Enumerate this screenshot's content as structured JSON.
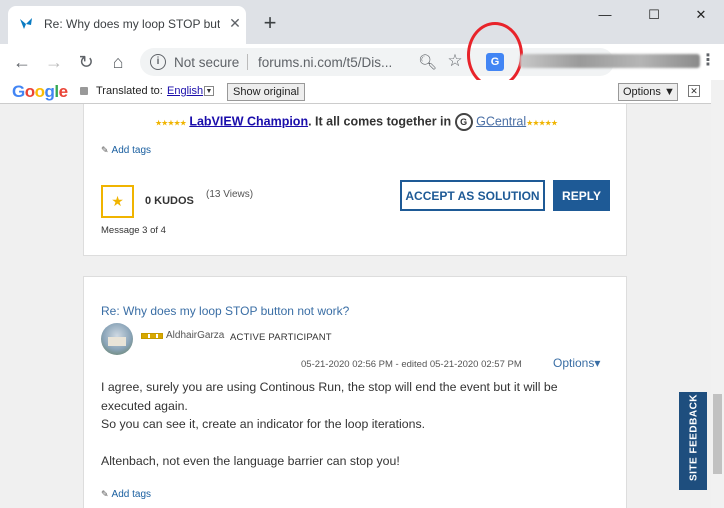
{
  "tab": {
    "title": "Re: Why does my loop STOP butt",
    "close": "✕",
    "new": "+"
  },
  "window": {
    "minimize": "—",
    "maximize": "☐",
    "close": "✕"
  },
  "toolbar": {
    "back": "←",
    "forward": "→",
    "reload": "↻",
    "home": "⌂"
  },
  "omnibox": {
    "security": "Not secure",
    "url": "forums.ni.com/t5/Dis..."
  },
  "translate_bar": {
    "google": [
      "G",
      "o",
      "o",
      "g",
      "l",
      "e"
    ],
    "translated_to": "Translated to:",
    "language": "English",
    "show_original": "Show original",
    "options": "Options ▼",
    "close": "✕"
  },
  "message3": {
    "stars_left": "★★★★★",
    "champion_link": "LabVIEW Champion",
    "tagline": ". It all comes together in ",
    "gcentral_icon": "G",
    "gcentral_link": "GCentral",
    "stars_right": "★★★★★",
    "add_tags": "Add tags",
    "kudos": "0 KUDOS",
    "views": "(13 Views)",
    "message_num": "Message 3 of 4",
    "accept": "ACCEPT AS SOLUTION",
    "reply": "REPLY"
  },
  "message4": {
    "title": "Re: Why does my loop STOP button not work?",
    "author": "AldhairGarza",
    "rank": "ACTIVE PARTICIPANT",
    "dates": "05-21-2020 02:56 PM - edited 05-21-2020 02:57 PM",
    "options": "Options▾",
    "body": [
      "I agree, surely you are using Continous Run, the stop will end the event but it will be executed again.",
      "So you can see it, create an indicator for the loop iterations.",
      "",
      "Altenbach, not even the language barrier can stop you!"
    ],
    "add_tags": "Add tags"
  },
  "site_feedback": "SITE FEEDBACK",
  "colors": {
    "accent": "#1e5a96",
    "kudo": "#f0b400",
    "annotation": "#e8232a"
  }
}
